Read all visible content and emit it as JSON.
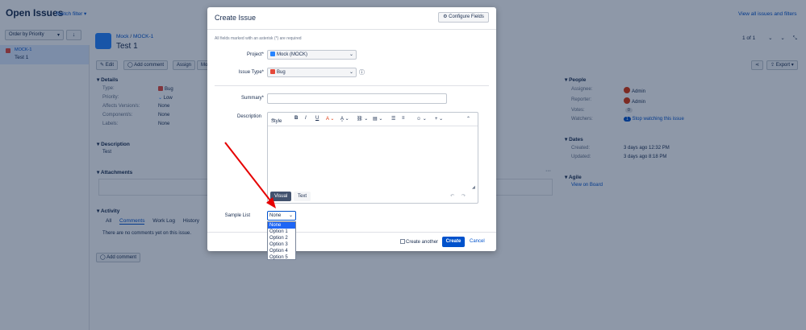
{
  "header": {
    "title": "Open Issues",
    "switch_filter": "Switch filter",
    "view_all": "View all issues and filters"
  },
  "issue_list": {
    "order_by": "Order by Priority",
    "items": [
      {
        "key": "MOCK-1",
        "summary": "Test 1"
      }
    ]
  },
  "issue": {
    "breadcrumb_project": "Mock",
    "breadcrumb_sep": "/",
    "breadcrumb_key": "MOCK-1",
    "title": "Test 1",
    "pager": "1 of 1",
    "toolbar": {
      "edit": "Edit",
      "add_comment": "Add comment",
      "assign": "Assign",
      "more": "Mo",
      "export": "Export"
    },
    "details": {
      "heading": "Details",
      "fields": [
        {
          "label": "Type:",
          "value": "Bug"
        },
        {
          "label": "Priority:",
          "value": "Low"
        },
        {
          "label": "Affects Version/s:",
          "value": "None"
        },
        {
          "label": "Component/s:",
          "value": "None"
        },
        {
          "label": "Labels:",
          "value": "None"
        }
      ]
    },
    "description": {
      "heading": "Description",
      "text": "Test"
    },
    "attachments": {
      "heading": "Attachments"
    },
    "activity": {
      "heading": "Activity",
      "tabs": [
        "All",
        "Comments",
        "Work Log",
        "History",
        "A"
      ],
      "empty": "There are no comments yet on this issue.",
      "add_comment": "Add comment"
    },
    "people": {
      "heading": "People",
      "assignee_label": "Assignee:",
      "assignee": "Admin",
      "reporter_label": "Reporter:",
      "reporter": "Admin",
      "votes_label": "Votes:",
      "votes": "0",
      "watchers_label": "Watchers:",
      "watchers_count": "1",
      "watchers_link": "Stop watching this issue"
    },
    "dates": {
      "heading": "Dates",
      "created_label": "Created:",
      "created": "3 days ago 12:32 PM",
      "updated_label": "Updated:",
      "updated": "3 days ago 8:18 PM"
    },
    "agile": {
      "heading": "Agile",
      "link": "View on Board"
    }
  },
  "dialog": {
    "title": "Create Issue",
    "configure_fields": "Configure Fields",
    "required_note": "All fields marked with an asterisk (*) are required",
    "project_label": "Project*",
    "project_value": "Mock (MOCK)",
    "issue_type_label": "Issue Type*",
    "issue_type_value": "Bug",
    "summary_label": "Summary*",
    "description_label": "Description",
    "editor": {
      "style": "Style",
      "visual": "Visual",
      "text": "Text"
    },
    "sample_list_label": "Sample List",
    "sample_list_value": "None",
    "sample_list_options": [
      "None",
      "Option 1",
      "Option 2",
      "Option 3",
      "Option 4",
      "Option 5"
    ],
    "create_another": "Create another",
    "create": "Create",
    "cancel": "Cancel"
  },
  "colors": {
    "accent": "#0052cc",
    "overlay": "#091e42",
    "bug": "#e5493a"
  }
}
